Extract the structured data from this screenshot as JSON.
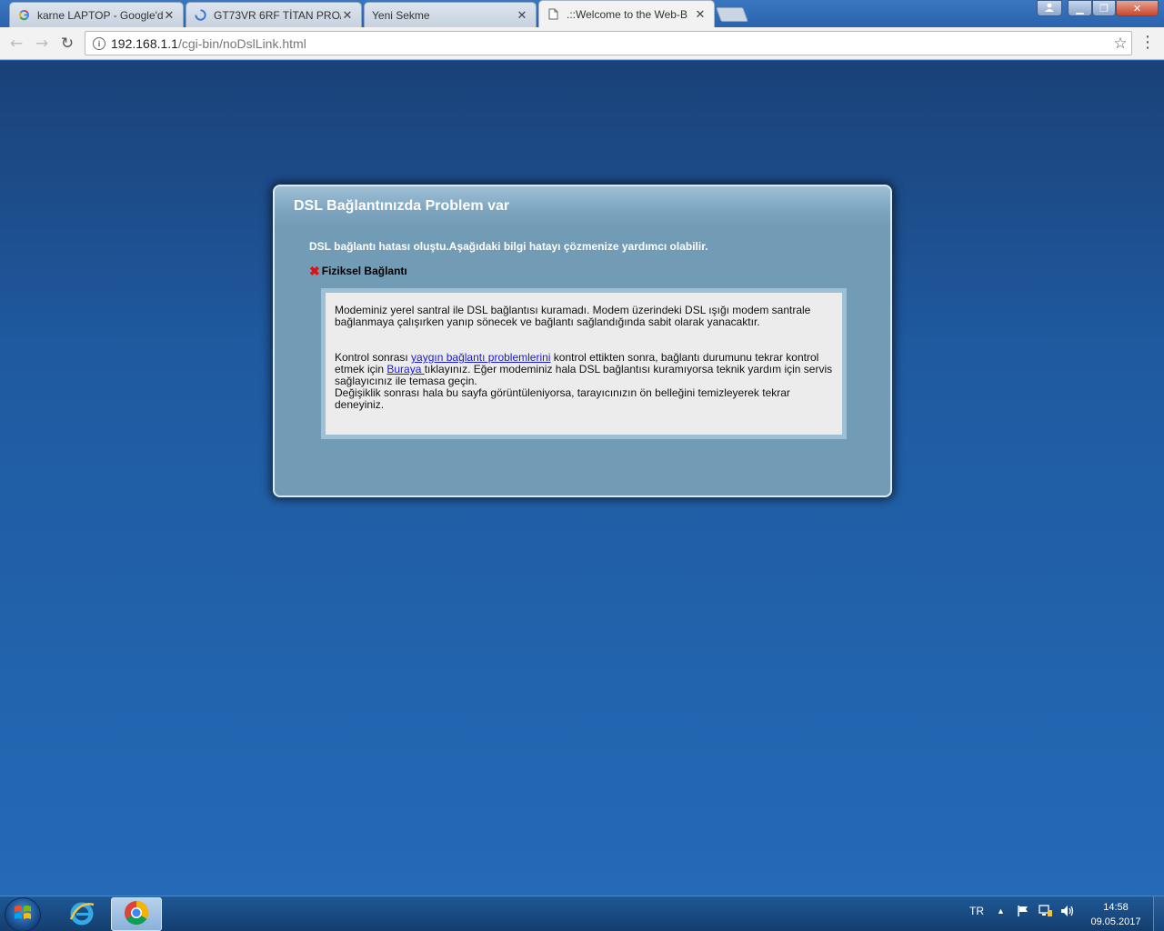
{
  "browser": {
    "tabs": [
      {
        "title": "karne LAPTOP - Google'd",
        "icon": "google-icon"
      },
      {
        "title": "GT73VR 6RF TİTAN PRO/",
        "icon": "loading-spinner-icon"
      },
      {
        "title": "Yeni Sekme",
        "icon": ""
      },
      {
        "title": ".::Welcome to the Web-B",
        "icon": "page-icon",
        "active": true
      }
    ],
    "url_host": "192.168.1.1",
    "url_path": "/cgi-bin/noDslLink.html"
  },
  "page": {
    "title": "DSL Bağlantınızda Problem var",
    "intro": "DSL bağlantı hatası oluştu.Aşağıdaki bilgi hatayı çözmenize yardımcı olabilir.",
    "physical_label": "Fiziksel Bağlantı",
    "physical_status": "failed",
    "paragraph1": "Modeminiz yerel santral ile DSL bağlantısı kuramadı. Modem üzerindeki DSL ışığı modem santrale bağlanmaya çalışırken yanıp sönecek ve bağlantı sağlandığında sabit olarak yanacaktır.",
    "p2_before": "Kontrol sonrası ",
    "p2_link1": "yaygın bağlantı problemlerini",
    "p2_mid": " kontrol ettikten sonra, bağlantı durumunu tekrar kontrol etmek için ",
    "p2_link2": "Buraya ",
    "p2_after": "tıklayınız. Eğer modeminiz hala DSL bağlantısı kuramıyorsa teknik yardım için servis sağlayıcınız ile temasa geçin.",
    "paragraph3": "Değişiklik sonrası hala bu sayfa görüntüleniyorsa, tarayıcınızın ön belleğini temizleyerek tekrar deneyiniz."
  },
  "taskbar": {
    "language": "TR",
    "time": "14:58",
    "date": "09.05.2017",
    "pinned": [
      "windows-start-icon",
      "internet-explorer-icon",
      "chrome-icon"
    ]
  },
  "colors": {
    "desktop_bg": "#1f5fa8",
    "panel_bg": "#729bb6",
    "infobox_bg": "#ececec",
    "link": "#1a1adb",
    "error_x": "#e01010"
  }
}
